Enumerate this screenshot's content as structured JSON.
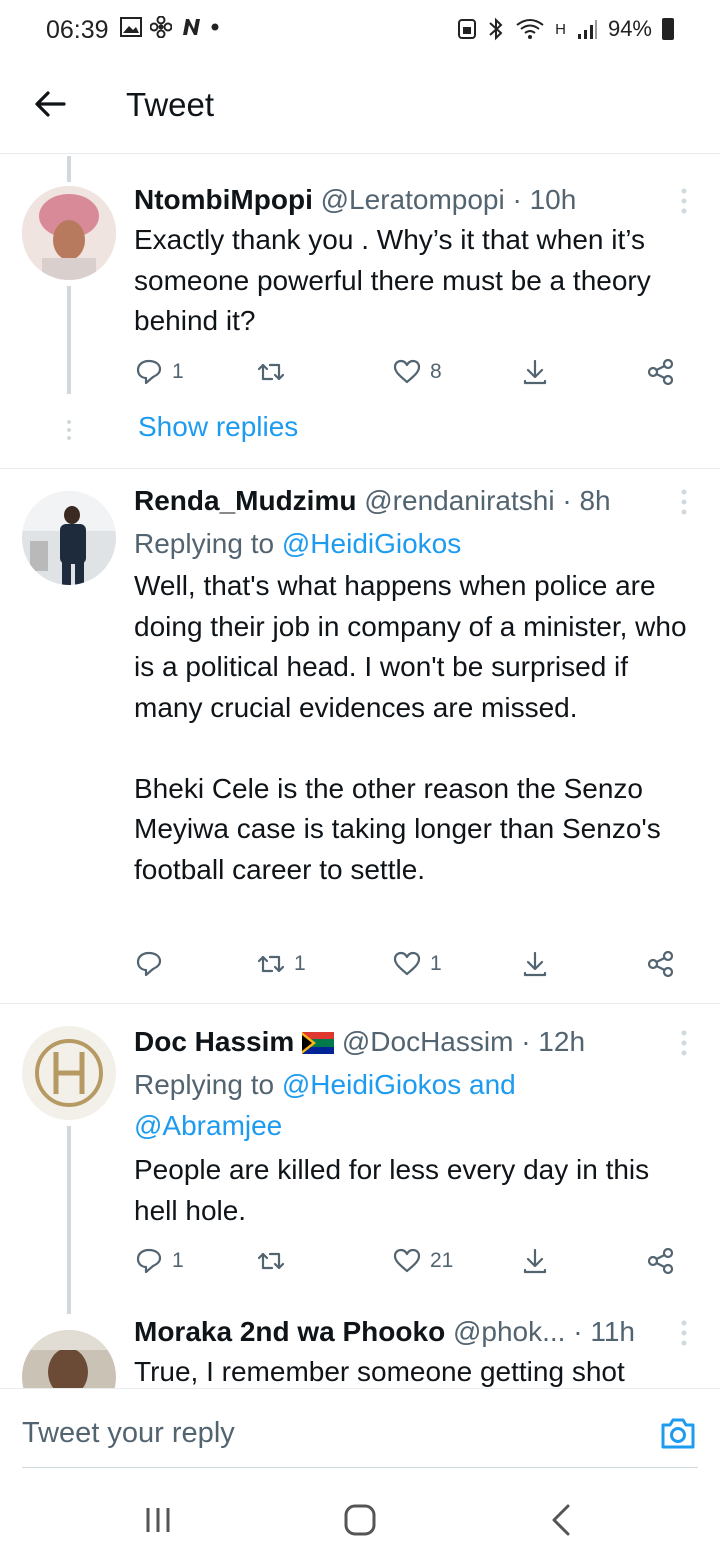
{
  "status_bar": {
    "time": "06:39",
    "left_icons": [
      "image-icon",
      "fan-icon",
      "n-icon",
      "dot-icon"
    ],
    "network": "H",
    "battery": "94%"
  },
  "app_bar": {
    "title": "Tweet"
  },
  "tweets": [
    {
      "name": "NtombiMpopi",
      "handle": "@Leratompopi",
      "time": "· 10h",
      "replying_prefix": "",
      "replying_mentions": "",
      "text": "Exactly thank you . Why’s it that when it’s someone powerful there must be a theory behind it?",
      "replies": "1",
      "retweets": "",
      "likes": "8",
      "show_replies": "Show replies"
    },
    {
      "name": "Renda_Mudzimu",
      "handle": "@rendaniratshi",
      "time": "· 8h",
      "replying_prefix": "Replying to",
      "replying_mentions": "@HeidiGiokos",
      "text": "Well, that's what happens when police are doing their job in company of a minister, who is a political head. I won't be surprised if many crucial evidences are missed.\n\nBheki Cele is the other reason the Senzo Meyiwa case is taking longer than Senzo's football career to settle.",
      "replies": "",
      "retweets": "1",
      "likes": "1"
    },
    {
      "name": "Doc Hassim",
      "flag": "south-africa-flag",
      "handle": "@DocHassim",
      "time": "· 12h",
      "replying_prefix": "Replying to",
      "replying_mentions_1": "@HeidiGiokos and",
      "replying_mentions_2": "@Abramjee",
      "text": "People are killed for less every day in this hell hole.",
      "replies": "1",
      "retweets": "",
      "likes": "21"
    },
    {
      "name": "Moraka 2nd wa Phooko",
      "handle": "@phok...",
      "time": "· 11h",
      "text": "True, I remember someone getting shot"
    }
  ],
  "reply_bar": {
    "placeholder": "Tweet your reply"
  },
  "colors": {
    "link": "#1d9bf0",
    "secondary": "#536471",
    "primary": "#0f1419",
    "border": "#e6ecf0"
  }
}
